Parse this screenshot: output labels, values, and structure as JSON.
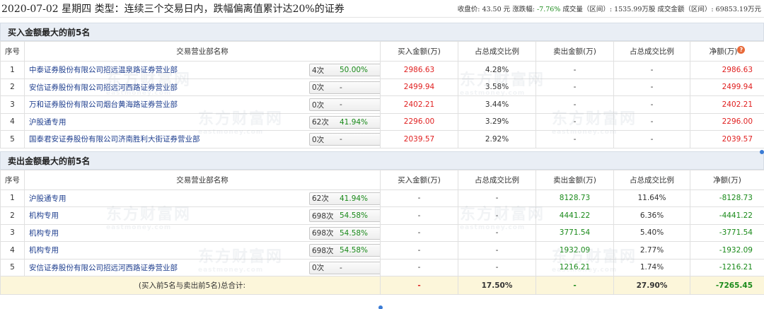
{
  "header": {
    "title": "2020-07-02 星期四  类型：连续三个交易日内，跌幅偏离值累计达20%的证券",
    "close_label": "收盘价:",
    "close_value": "43.50 元",
    "change_label": "涨跌幅:",
    "change_value": "-7.76%",
    "volume_label": "成交量（区间）:",
    "volume_value": "1535.99万股",
    "amount_label": "成交金额（区间）:",
    "amount_value": "69853.19万元"
  },
  "buy_section": {
    "title": "买入金额最大的前5名",
    "columns": [
      "序号",
      "交易营业部名称",
      "买入金额(万)",
      "占总成交比例",
      "卖出金额(万)",
      "占总成交比例",
      "净额(万)"
    ],
    "rows": [
      {
        "idx": "1",
        "name": "中泰证券股份有限公司招远温泉路证券营业部",
        "cnt": "4次",
        "pct": "50.00%",
        "buy": "2986.63",
        "buy_ratio": "4.28%",
        "sell": "-",
        "sell_ratio": "-",
        "net": "2986.63",
        "has_q": true
      },
      {
        "idx": "2",
        "name": "安信证券股份有限公司招远河西路证券营业部",
        "cnt": "0次",
        "pct": "-",
        "buy": "2499.94",
        "buy_ratio": "3.58%",
        "sell": "-",
        "sell_ratio": "-",
        "net": "2499.94"
      },
      {
        "idx": "3",
        "name": "万和证券股份有限公司烟台黄海路证券营业部",
        "cnt": "0次",
        "pct": "-",
        "buy": "2402.21",
        "buy_ratio": "3.44%",
        "sell": "-",
        "sell_ratio": "-",
        "net": "2402.21"
      },
      {
        "idx": "4",
        "name": "沪股通专用",
        "cnt": "62次",
        "pct": "41.94%",
        "buy": "2296.00",
        "buy_ratio": "3.29%",
        "sell": "-",
        "sell_ratio": "-",
        "net": "2296.00"
      },
      {
        "idx": "5",
        "name": "国泰君安证券股份有限公司济南胜利大街证券营业部",
        "cnt": "0次",
        "pct": "-",
        "buy": "2039.57",
        "buy_ratio": "2.92%",
        "sell": "-",
        "sell_ratio": "-",
        "net": "2039.57"
      }
    ]
  },
  "sell_section": {
    "title": "卖出金额最大的前5名",
    "columns": [
      "序号",
      "交易营业部名称",
      "买入金额(万)",
      "占总成交比例",
      "卖出金额(万)",
      "占总成交比例",
      "净额(万)"
    ],
    "rows": [
      {
        "idx": "1",
        "name": "沪股通专用",
        "cnt": "62次",
        "pct": "41.94%",
        "buy": "-",
        "buy_ratio": "-",
        "sell": "8128.73",
        "sell_ratio": "11.64%",
        "net": "-8128.73"
      },
      {
        "idx": "2",
        "name": "机构专用",
        "cnt": "698次",
        "pct": "54.58%",
        "buy": "-",
        "buy_ratio": "-",
        "sell": "4441.22",
        "sell_ratio": "6.36%",
        "net": "-4441.22"
      },
      {
        "idx": "3",
        "name": "机构专用",
        "cnt": "698次",
        "pct": "54.58%",
        "buy": "-",
        "buy_ratio": "-",
        "sell": "3771.54",
        "sell_ratio": "5.40%",
        "net": "-3771.54"
      },
      {
        "idx": "4",
        "name": "机构专用",
        "cnt": "698次",
        "pct": "54.58%",
        "buy": "-",
        "buy_ratio": "-",
        "sell": "1932.09",
        "sell_ratio": "2.77%",
        "net": "-1932.09"
      },
      {
        "idx": "5",
        "name": "安信证券股份有限公司招远河西路证券营业部",
        "cnt": "0次",
        "pct": "-",
        "buy": "-",
        "buy_ratio": "-",
        "sell": "1216.21",
        "sell_ratio": "1.74%",
        "net": "-1216.21"
      }
    ],
    "total": {
      "label": "(买入前5名与卖出前5名)总合计:",
      "buy": "-",
      "buy_ratio": "17.50%",
      "sell": "-",
      "sell_ratio": "27.90%",
      "net": "-7265.45"
    }
  },
  "watermark": {
    "cn": "东方财富网",
    "en": "eastmoney.com"
  },
  "colors": {
    "red": "#e01f1f",
    "green": "#1a8a1a",
    "link": "#1f3f8f",
    "section_bg": "#e9eef5",
    "total_bg": "#fcf6da",
    "qmark": "#e86a3a"
  },
  "icons": {
    "row_arrow": "triangle-right-icon",
    "help": "question-icon"
  }
}
